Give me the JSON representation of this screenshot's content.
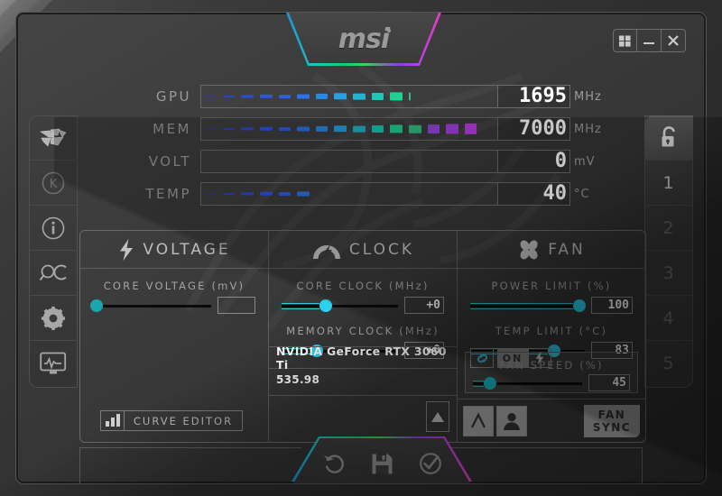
{
  "window": {
    "brand": "msi",
    "controls": [
      {
        "name": "windows-button",
        "icon": "windows-icon"
      },
      {
        "name": "minimize-button",
        "icon": "minimize-icon"
      },
      {
        "name": "close-button",
        "icon": "close-icon"
      }
    ]
  },
  "monitors": [
    {
      "label": "GPU",
      "value": "1695",
      "unit": "MHz",
      "fill": 0.63,
      "segments": 11
    },
    {
      "label": "MEM",
      "value": "7000",
      "unit": "MHz",
      "fill": 0.95,
      "segments": 15
    },
    {
      "label": "VOLT",
      "value": "0",
      "unit": "mV",
      "fill": 0.0,
      "segments": 0
    },
    {
      "label": "TEMP",
      "value": "40",
      "unit": "°C",
      "fill": 0.3,
      "segments": 6
    }
  ],
  "left_rail": [
    {
      "name": "msi-dragon-logo-icon",
      "label": "dragon"
    },
    {
      "name": "kombustor-icon",
      "label": "K"
    },
    {
      "name": "info-icon",
      "label": "i"
    },
    {
      "name": "oc-scanner-icon",
      "label": "QC"
    },
    {
      "name": "settings-gear-icon",
      "label": "gear"
    },
    {
      "name": "monitoring-icon",
      "label": "monitor"
    }
  ],
  "right_rail": {
    "lock": {
      "name": "unlock-icon",
      "label": "unlock"
    },
    "profiles": [
      "1",
      "2",
      "3",
      "4",
      "5"
    ]
  },
  "panels": {
    "voltage": {
      "title": "VOLTAGE",
      "icon": "lightning-bolt-icon",
      "core_voltage": {
        "label": "CORE VOLTAGE  (mV)",
        "value": "",
        "fill": 0.0
      },
      "curve_editor": {
        "label": "CURVE EDITOR",
        "icon": "bar-chart-icon"
      }
    },
    "clock": {
      "title": "CLOCK",
      "icon": "speedometer-icon",
      "core_clock": {
        "label": "CORE CLOCK (MHz)",
        "value": "+0",
        "fill": 0.38
      },
      "memory_clock": {
        "label": "MEMORY CLOCK (MHz)",
        "value": "+0",
        "fill": 0.3
      },
      "gpu_name": "NVIDIA GeForce RTX 3060 Ti",
      "driver_version": "535.98",
      "expand_button": {
        "name": "expand-up-button",
        "icon": "triangle-up-icon"
      }
    },
    "fan": {
      "title": "FAN",
      "icon": "fan-blades-icon",
      "power_limit": {
        "label": "POWER LIMIT (%)",
        "value": "100",
        "fill": 1.0
      },
      "temp_limit": {
        "label": "TEMP LIMIT (°C)",
        "value": "83",
        "fill": 0.73
      },
      "link_button": {
        "name": "link-limits-button",
        "icon": "chain-link-icon"
      },
      "on_button": {
        "label": "ON"
      },
      "boost_button": {
        "name": "boost-button",
        "icon": "lightning-bolt-icon"
      },
      "fan_speed": {
        "label": "FAN SPEED (%)",
        "value": "45",
        "fill": 0.16
      },
      "auto_button": {
        "name": "auto-fan-button",
        "label": "A"
      },
      "user_button": {
        "name": "user-profile-button",
        "icon": "person-icon"
      },
      "fan_sync": {
        "line1": "FAN",
        "line2": "SYNC"
      }
    }
  },
  "actions": [
    {
      "name": "reset-button",
      "icon": "reset-arrow-icon"
    },
    {
      "name": "save-button",
      "icon": "floppy-disk-icon"
    },
    {
      "name": "apply-button",
      "icon": "check-circle-icon"
    }
  ],
  "colors": {
    "accent_cyan": "#2ad2f0",
    "accent_teal": "#19a6ae",
    "rgb_start": "#1f8fd6",
    "rgb_green": "#19c96f",
    "rgb_purple": "#8a3fe0",
    "rgb_magenta": "#e03fc0",
    "text_primary": "#ffffff",
    "text_muted": "#9b9b9b"
  }
}
